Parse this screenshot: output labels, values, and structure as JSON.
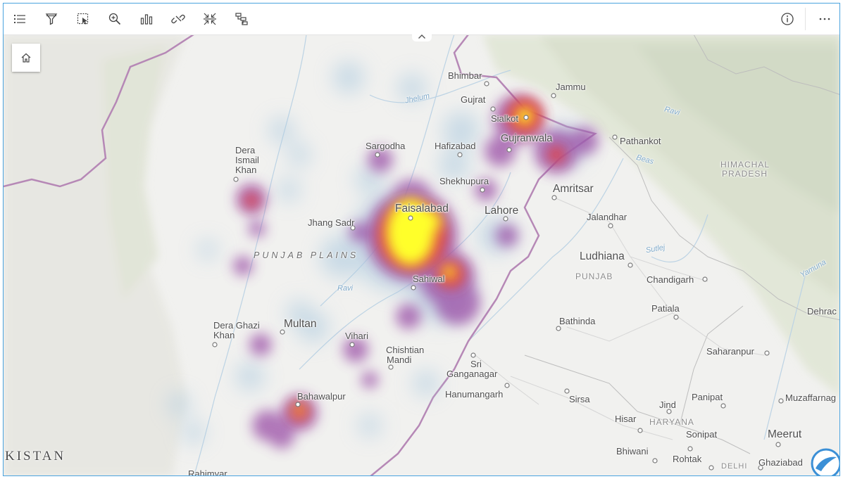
{
  "toolbar": {
    "tools": [
      "legend",
      "filter",
      "select",
      "zoom",
      "bar-chart",
      "link",
      "fit-extent",
      "sort"
    ],
    "right": [
      "info",
      "more"
    ]
  },
  "map": {
    "colors": {
      "land": "#f2f2f0",
      "terrain": "#e4e8d9",
      "border": "#b07ab0",
      "heat_low": "#b5c8d8",
      "heat_mid": "#8e3a9c",
      "heat_high": "#e03040",
      "heat_max": "#ffff1a"
    },
    "labels": {
      "bhimbar": "Bhimbar",
      "jammu": "Jammu",
      "gujrat": "Gujrat",
      "sialkot": "Sialkot",
      "gujranwala": "Gujranwala",
      "hafizabad": "Hafizabad",
      "sargodha": "Sargodha",
      "pathankot": "Pathankot",
      "dera_ismail_khan_1": "Dera",
      "dera_ismail_khan_2": "Ismail",
      "dera_ismail_khan_3": "Khan",
      "himachal_1": "HIMACHAL",
      "himachal_2": "PRADESH",
      "shekhupura": "Shekhupura",
      "amritsar": "Amritsar",
      "faisalabad": "Faisalabad",
      "lahore": "Lahore",
      "jalandhar": "Jalandhar",
      "jhang_sadr": "Jhang Sadr",
      "punjab_plains": "PUNJAB PLAINS",
      "ludhiana": "Ludhiana",
      "punjab": "PUNJAB",
      "chandigarh": "Chandigarh",
      "sahiwal": "Sahiwal",
      "patiala": "Patiala",
      "dehradun": "Dehrac",
      "bathinda": "Bathinda",
      "dera_ghazi_khan_1": "Dera Ghazi",
      "dera_ghazi_khan_2": "Khan",
      "multan": "Multan",
      "vihari": "Vihari",
      "chishtian_1": "Chishtian",
      "chishtian_2": "Mandi",
      "saharanpur": "Saharanpur",
      "sri_ganganagar_1": "Sri",
      "sri_ganganagar_2": "Ganganagar",
      "hanumangarh": "Hanumangarh",
      "bahawalpur": "Bahawalpur",
      "sirsa": "Sirsa",
      "jind": "Jind",
      "panipat": "Panipat",
      "muzaffarnagar": "Muzaffarnag",
      "hisar": "Hisar",
      "haryana": "HARYANA",
      "sonipat": "Sonipat",
      "meerut": "Meerut",
      "bhiwani": "Bhiwani",
      "rohtak": "Rohtak",
      "delhi": "DELHI",
      "ghaziabad": "Ghaziabad",
      "rahimyar": "Rahimyar",
      "kistan": "KISTAN"
    },
    "rivers": {
      "jhelum": "Jhelum",
      "ravi_in": "Ravi",
      "beas": "Beas",
      "sutlej": "Sutlej",
      "ravi": "Ravi",
      "yamuna": "Yamuna"
    }
  }
}
